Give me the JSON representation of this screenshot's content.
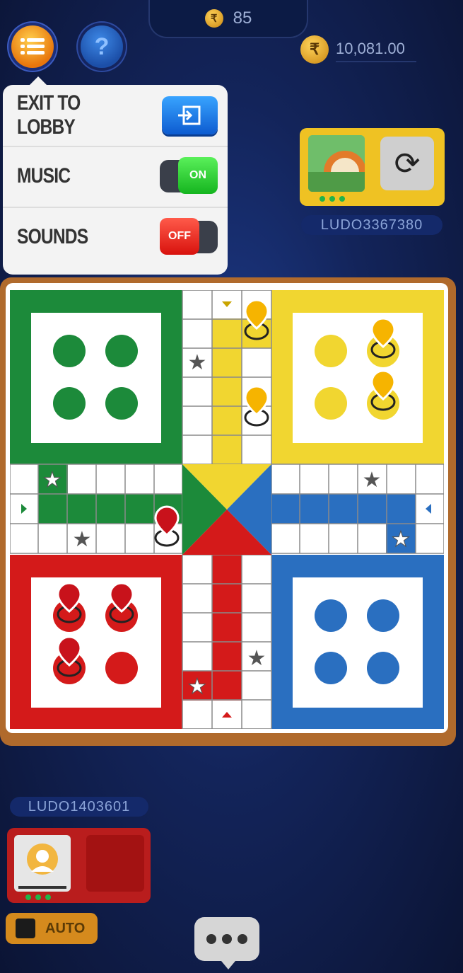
{
  "header": {
    "entry_fee": "85",
    "entry_coin_icon": "rupee-coin-icon",
    "balance": "10,081.00",
    "balance_coin_icon": "rupee-coin-icon"
  },
  "menu_popup": {
    "exit_label": "EXIT TO LOBBY",
    "music_label": "MUSIC",
    "music_state": "ON",
    "sounds_label": "SOUNDS",
    "sounds_state": "OFF"
  },
  "opponent": {
    "name": "LUDO3367380",
    "color": "#efc223"
  },
  "player": {
    "name": "LUDO1403601",
    "color": "#b91d1d"
  },
  "controls": {
    "auto_label": "AUTO"
  },
  "colors": {
    "green": "#1c8a3a",
    "yellow": "#f1d630",
    "red": "#d41a1a",
    "blue": "#2a6fc0",
    "board_frame": "#b06a2c"
  }
}
